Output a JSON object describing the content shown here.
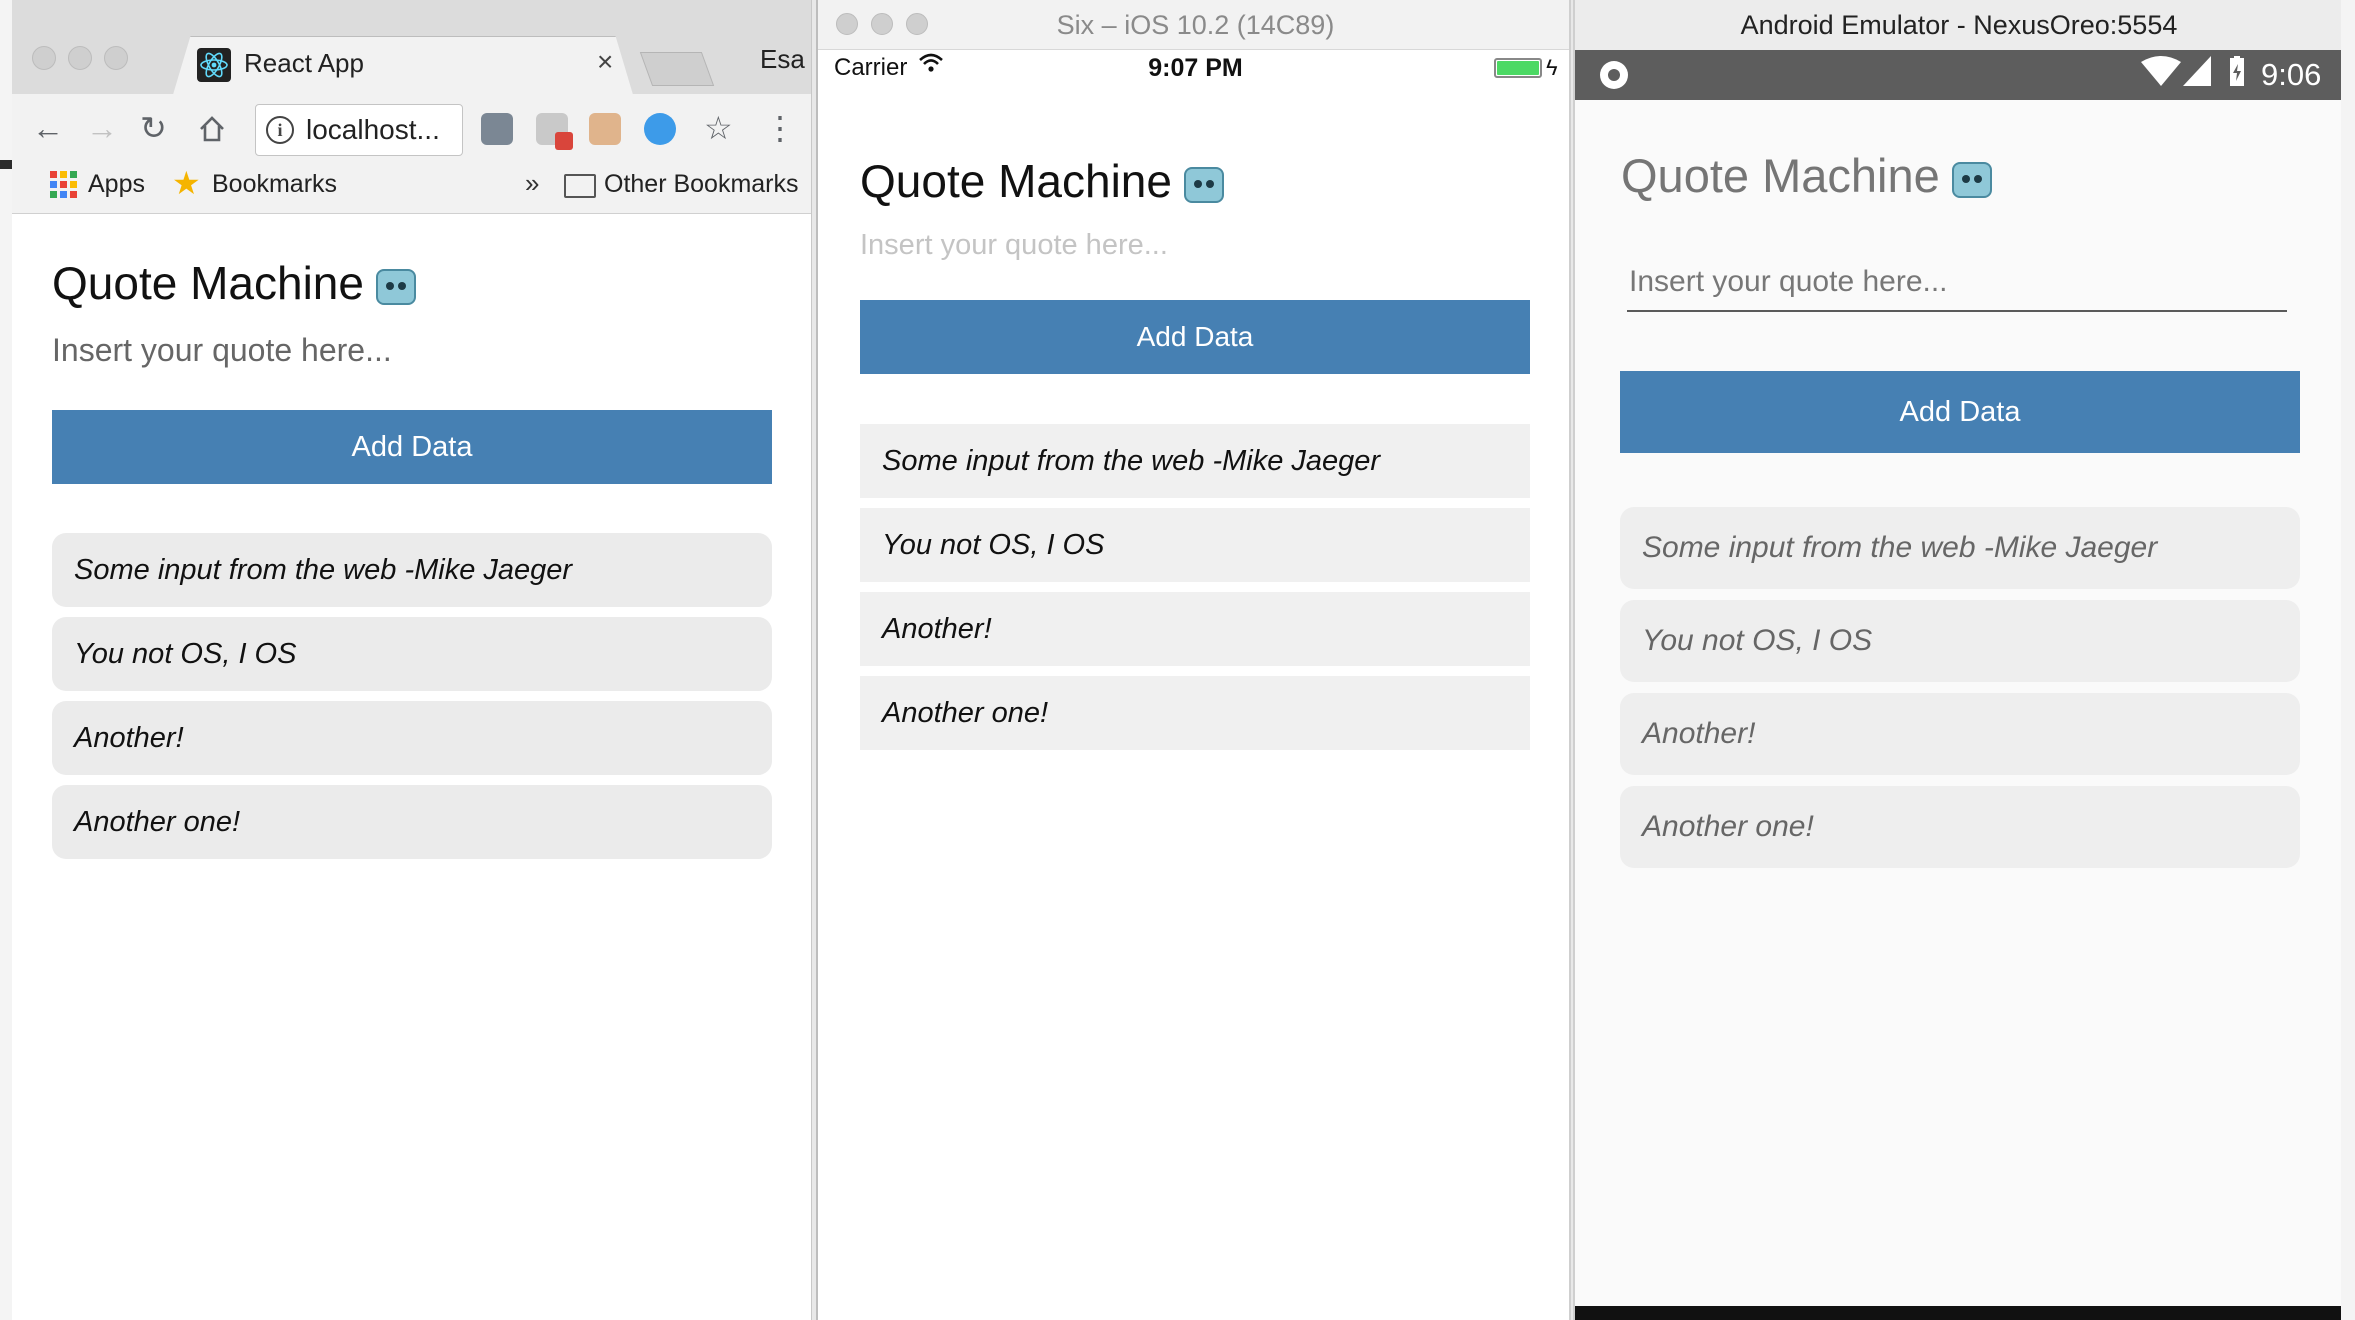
{
  "chrome": {
    "tab_title": "React App",
    "tab_close": "×",
    "profile_name": "Esa",
    "address": "localhost...",
    "bookmarks": {
      "apps": "Apps",
      "bookmarks": "Bookmarks",
      "chevron": "»",
      "other": "Other Bookmarks"
    },
    "app": {
      "title": "Quote Machine",
      "placeholder": "Insert your quote here...",
      "button": "Add Data",
      "quotes": [
        "Some input from the web -Mike Jaeger",
        "You not OS, I OS",
        "Another!",
        "Another one!"
      ]
    }
  },
  "ios": {
    "window_title": "Six – iOS 10.2 (14C89)",
    "carrier": "Carrier",
    "time": "9:07 PM",
    "app": {
      "title": "Quote Machine",
      "placeholder": "Insert your quote here...",
      "button": "Add Data",
      "quotes": [
        "Some input from the web -Mike Jaeger",
        "You not OS, I OS",
        "Another!",
        "Another one!"
      ]
    }
  },
  "android": {
    "window_title": "Android Emulator - NexusOreo:5554",
    "time": "9:06",
    "app": {
      "title": "Quote Machine",
      "placeholder": "Insert your quote here...",
      "button": "Add Data",
      "quotes": [
        "Some input from the web -Mike Jaeger",
        "You not OS, I OS",
        "Another!",
        "Another one!"
      ]
    }
  },
  "colors": {
    "button_blue": "#4680b3",
    "battery_green": "#4cd964",
    "android_statusbar": "#5d5d5d"
  },
  "icons": {
    "back": "back-arrow-icon",
    "forward": "forward-arrow-icon",
    "reload": "reload-icon",
    "home": "home-icon",
    "star": "star-icon",
    "menu": "kebab-menu-icon",
    "robot": "robot-emoji-icon"
  }
}
